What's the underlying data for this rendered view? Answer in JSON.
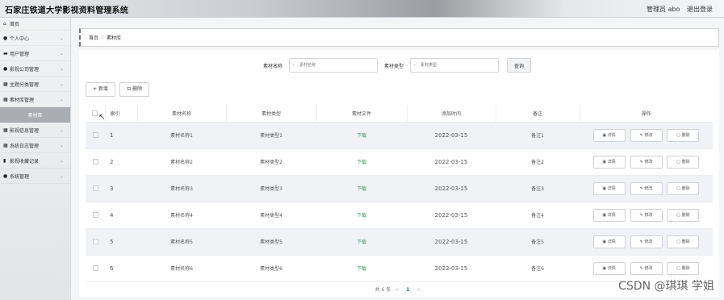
{
  "header": {
    "app_title": "石家庄铁道大学影视资料管理系统",
    "username": "管理员 abo",
    "logout_label": "退出登录"
  },
  "sidebar": {
    "items": [
      {
        "label": "首页",
        "icon": "home-icon",
        "chev": ""
      },
      {
        "label": "个人中心",
        "icon": "user-icon",
        "chev": "⌄"
      },
      {
        "label": "用户管理",
        "icon": "users-icon",
        "chev": "⌄"
      },
      {
        "label": "影视公司管理",
        "icon": "person-icon",
        "chev": "⌄"
      },
      {
        "label": "主题分类管理",
        "icon": "grid-icon",
        "chev": "⌄"
      },
      {
        "label": "素材库管理",
        "icon": "grid-icon",
        "chev": "⌄"
      },
      {
        "label": "素材库",
        "icon": "",
        "chev": ""
      },
      {
        "label": "影视信息管理",
        "icon": "grid-icon",
        "chev": "⌄"
      },
      {
        "label": "系统日志管理",
        "icon": "grid-icon",
        "chev": "⌄"
      },
      {
        "label": "影视收藏记录",
        "icon": "book-icon",
        "chev": "⌄"
      },
      {
        "label": "系统管理",
        "icon": "person-icon",
        "chev": "⌄"
      }
    ]
  },
  "breadcrumb": {
    "home": "首页",
    "current": "素材库"
  },
  "search": {
    "name_label": "素材名称",
    "name_placeholder": "素材名称",
    "type_label": "素材类型",
    "type_placeholder": "素材类型",
    "query_button": "查询"
  },
  "actions": {
    "add_label": "+ 新增",
    "delete_label": "⊟ 删除"
  },
  "table": {
    "columns": [
      "索引",
      "素材名称",
      "素材类型",
      "素材文件",
      "添加时间",
      "备注",
      "操作"
    ],
    "rows": [
      {
        "index": "1",
        "name": "素材名称1",
        "type": "素材类型1",
        "file": "下载",
        "date": "2022-03-15",
        "note": "备注1"
      },
      {
        "index": "2",
        "name": "素材名称2",
        "type": "素材类型2",
        "file": "下载",
        "date": "2022-03-15",
        "note": "备注2"
      },
      {
        "index": "3",
        "name": "素材名称3",
        "type": "素材类型3",
        "file": "下载",
        "date": "2022-03-15",
        "note": "备注3"
      },
      {
        "index": "4",
        "name": "素材名称4",
        "type": "素材类型4",
        "file": "下载",
        "date": "2022-03-15",
        "note": "备注4"
      },
      {
        "index": "5",
        "name": "素材名称5",
        "type": "素材类型5",
        "file": "下载",
        "date": "2022-03-15",
        "note": "备注5"
      },
      {
        "index": "6",
        "name": "素材名称6",
        "type": "素材类型6",
        "file": "下载",
        "date": "2022-03-15",
        "note": "备注6"
      }
    ],
    "op_detail": "详情",
    "op_edit": "修改",
    "op_delete": "删除"
  },
  "pagination": {
    "total": "共 6 条",
    "prev": "<",
    "current": "1",
    "next": ">"
  },
  "watermark": "CSDN @琪琪 学姐"
}
